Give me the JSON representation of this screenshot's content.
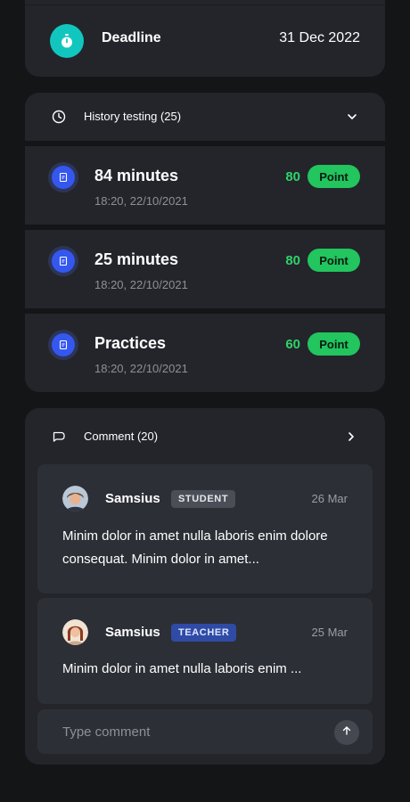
{
  "deadline": {
    "label": "Deadline",
    "value": "31 Dec 2022",
    "icon": "stopwatch-icon",
    "accent": "#12c6c0"
  },
  "history": {
    "title": "History testing (25)",
    "icon": "clock-icon",
    "toggle_icon": "chevron-down-icon",
    "items": [
      {
        "title": "84 minutes",
        "time": "18:20, 22/10/2021",
        "score": "80",
        "badge": "Point"
      },
      {
        "title": "25 minutes",
        "time": "18:20, 22/10/2021",
        "score": "80",
        "badge": "Point"
      },
      {
        "title": "Practices",
        "time": "18:20, 22/10/2021",
        "score": "60",
        "badge": "Point"
      }
    ]
  },
  "comments": {
    "title": "Comment (20)",
    "icon": "chat-bubble-icon",
    "toggle_icon": "chevron-right-icon",
    "items": [
      {
        "name": "Samsius",
        "role": "STUDENT",
        "date": "26 Mar",
        "text": "Minim dolor in amet nulla laboris enim dolore consequat. Minim dolor in amet..."
      },
      {
        "name": "Samsius",
        "role": "TEACHER",
        "date": "25 Mar",
        "text": "Minim dolor in amet nulla laboris enim ..."
      }
    ],
    "input": {
      "placeholder": "Type comment",
      "value": ""
    },
    "send_icon": "arrow-up-icon"
  },
  "colors": {
    "background": "#141517",
    "card": "#23252b",
    "score_green": "#2fd26a",
    "point_badge": "#22c55e",
    "doc_badge": "#3457f0",
    "student_badge": "#4a4e57",
    "teacher_badge": "#2f4ba5"
  }
}
